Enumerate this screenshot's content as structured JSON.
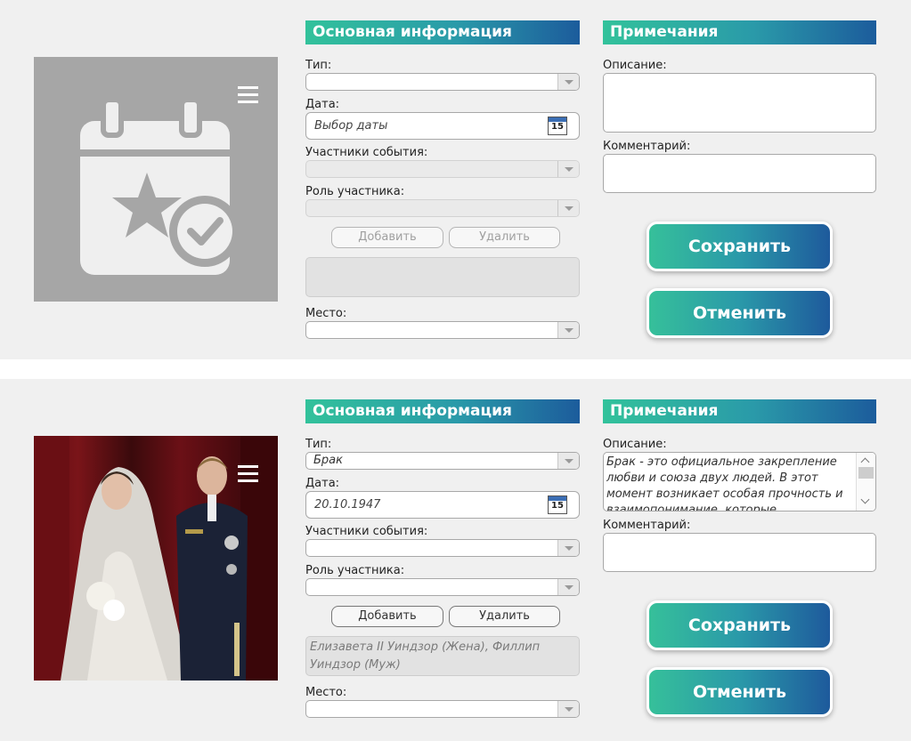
{
  "colors": {
    "accent_start": "#32c29b",
    "accent_end": "#1c5c9c",
    "panel_bg": "#f0f0f0"
  },
  "forms": [
    {
      "photo": "calendar-star-check-icon",
      "main_header": "Основная информация",
      "notes_header": "Примечания",
      "type_label": "Тип:",
      "type_value": "",
      "date_label": "Дата:",
      "date_value": "Выбор даты",
      "calendar_day": "15",
      "participants_label": "Участники события:",
      "participants_value": "",
      "role_label": "Роль участника:",
      "role_value": "",
      "add_label": "Добавить",
      "delete_label": "Удалить",
      "participants_list": "",
      "place_label": "Место:",
      "place_value": "",
      "description_label": "Описание:",
      "description_value": "",
      "comment_label": "Комментарий:",
      "comment_value": "",
      "save_label": "Сохранить",
      "cancel_label": "Отменить"
    },
    {
      "photo": "wedding-photo",
      "main_header": "Основная информация",
      "notes_header": "Примечания",
      "type_label": "Тип:",
      "type_value": "Брак",
      "date_label": "Дата:",
      "date_value": "20.10.1947",
      "calendar_day": "15",
      "participants_label": "Участники события:",
      "participants_value": "",
      "role_label": "Роль участника:",
      "role_value": "",
      "add_label": "Добавить",
      "delete_label": "Удалить",
      "participants_list": "Елизавета II Уиндзор (Жена), Филлип Уиндзор (Муж)",
      "place_label": "Место:",
      "place_value": "",
      "description_label": "Описание:",
      "description_value": "Брак - это официальное закрепление любви и союза двух людей. В этот момент возникает особая прочность и взаимопонимание, которые",
      "comment_label": "Комментарий:",
      "comment_value": "",
      "save_label": "Сохранить",
      "cancel_label": "Отменить"
    }
  ]
}
